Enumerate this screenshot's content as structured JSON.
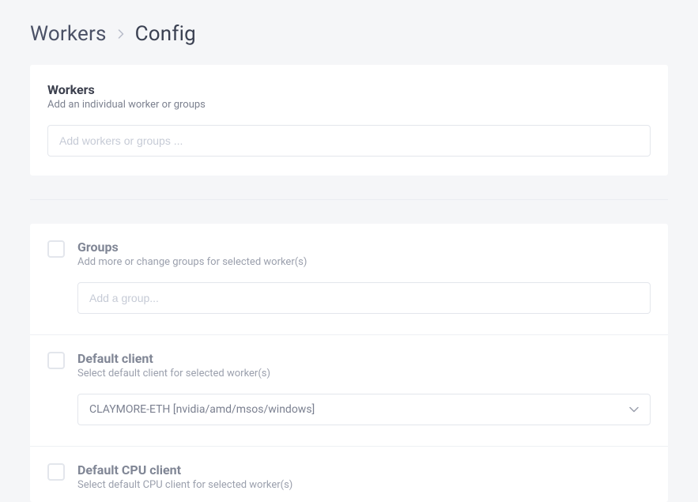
{
  "breadcrumb": {
    "parent": "Workers",
    "current": "Config"
  },
  "workers_panel": {
    "title": "Workers",
    "subtitle": "Add an individual worker or groups",
    "placeholder": "Add workers or groups ..."
  },
  "sections": {
    "groups": {
      "title": "Groups",
      "subtitle": "Add more or change groups for selected worker(s)",
      "placeholder": "Add a group..."
    },
    "default_client": {
      "title": "Default client",
      "subtitle": "Select default client for selected worker(s)",
      "selected": "CLAYMORE-ETH [nvidia/amd/msos/windows]"
    },
    "default_cpu_client": {
      "title": "Default CPU client",
      "subtitle": "Select default CPU client for selected worker(s)"
    }
  }
}
